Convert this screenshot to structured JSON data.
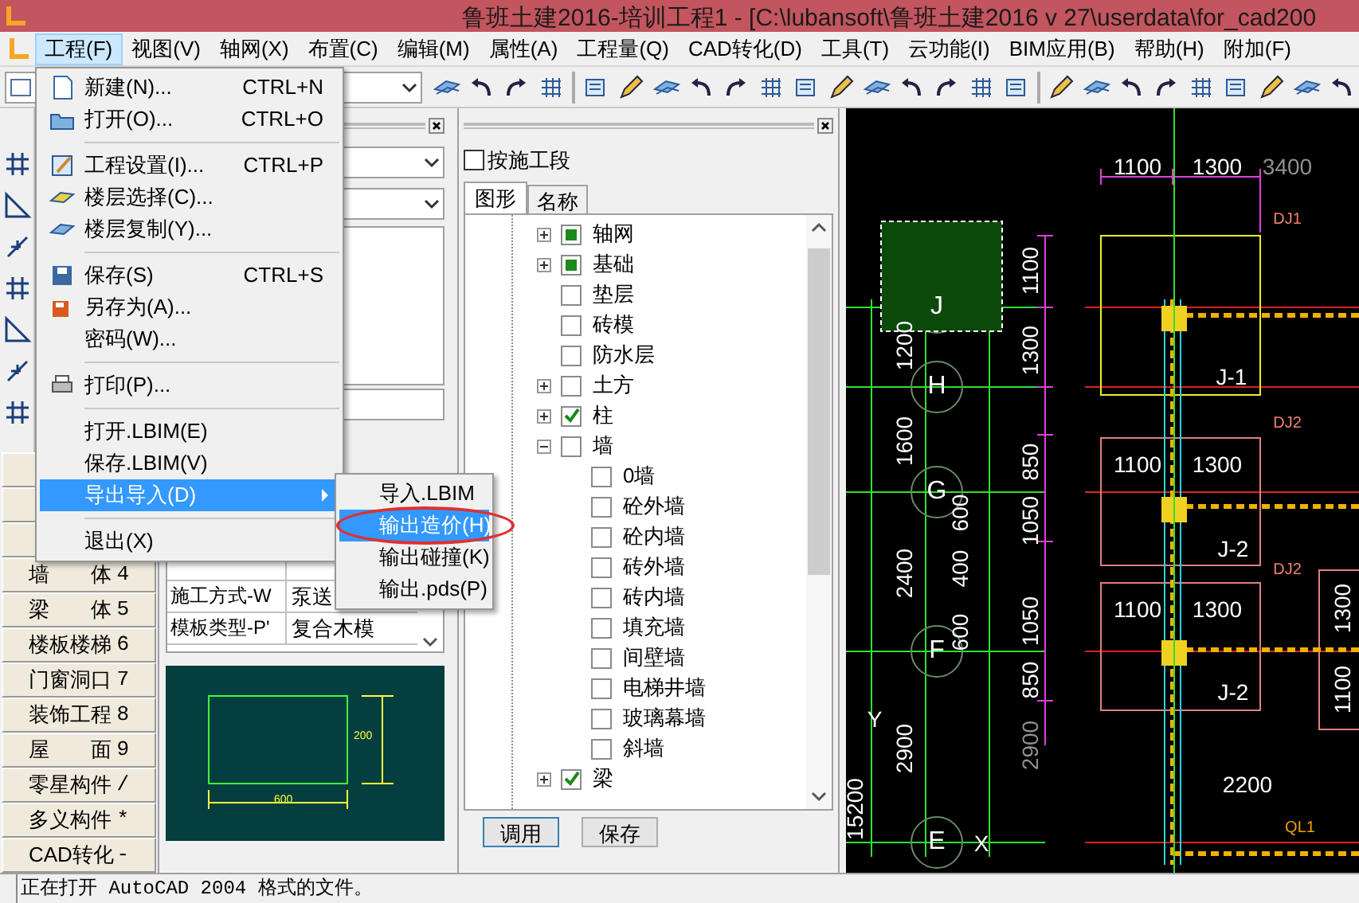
{
  "window": {
    "title": "鲁班土建2016-培训工程1 - [C:\\lubansoft\\鲁班土建2016 v 27\\userdata\\for_cad200"
  },
  "menubar": [
    {
      "label": "工程(F)",
      "selected": true
    },
    {
      "label": "视图(V)",
      "selected": false
    },
    {
      "label": "轴网(X)",
      "selected": false
    },
    {
      "label": "布置(C)",
      "selected": false
    },
    {
      "label": "编辑(M)",
      "selected": false
    },
    {
      "label": "属性(A)",
      "selected": false
    },
    {
      "label": "工程量(Q)",
      "selected": false
    },
    {
      "label": "CAD转化(D)",
      "selected": false
    },
    {
      "label": "工具(T)",
      "selected": false
    },
    {
      "label": "云功能(I)",
      "selected": false
    },
    {
      "label": "BIM应用(B)",
      "selected": false
    },
    {
      "label": "帮助(H)",
      "selected": false
    },
    {
      "label": "附加(F)",
      "selected": false
    }
  ],
  "file_menu": [
    {
      "kind": "item",
      "label": "新建(N)...",
      "shortcut": "CTRL+N",
      "selected": false
    },
    {
      "kind": "item",
      "label": "打开(O)...",
      "shortcut": "CTRL+O",
      "selected": false
    },
    {
      "kind": "separator"
    },
    {
      "kind": "item",
      "label": "工程设置(I)...",
      "shortcut": "CTRL+P",
      "selected": false
    },
    {
      "kind": "item",
      "label": "楼层选择(C)...",
      "selected": false
    },
    {
      "kind": "item",
      "label": "楼层复制(Y)...",
      "selected": false
    },
    {
      "kind": "separator"
    },
    {
      "kind": "item",
      "label": "保存(S)",
      "shortcut": "CTRL+S",
      "selected": false
    },
    {
      "kind": "item",
      "label": "另存为(A)...",
      "selected": false
    },
    {
      "kind": "item",
      "label": "密码(W)...",
      "selected": false
    },
    {
      "kind": "separator"
    },
    {
      "kind": "item",
      "label": "打印(P)...",
      "selected": false
    },
    {
      "kind": "separator"
    },
    {
      "kind": "item",
      "label": "打开.LBIM(E)",
      "selected": false
    },
    {
      "kind": "item",
      "label": "保存.LBIM(V)",
      "selected": false
    },
    {
      "kind": "submenu",
      "label": "导出导入(D)",
      "selected": true
    },
    {
      "kind": "separator"
    },
    {
      "kind": "item",
      "label": "退出(X)",
      "selected": false
    }
  ],
  "submenu": [
    {
      "label": "导入.LBIM",
      "selected": false,
      "circled": false
    },
    {
      "label": "输出造价(H)",
      "selected": true,
      "circled": true
    },
    {
      "label": "输出碰撞(K)",
      "selected": false,
      "circled": false
    },
    {
      "label": "输出.pds(P)",
      "selected": false,
      "circled": false
    }
  ],
  "left_panel": {
    "categories": [
      {
        "label": "墙　　体",
        "key": "4"
      },
      {
        "label": "梁　　体",
        "key": "5"
      },
      {
        "label": "楼板楼梯",
        "key": "6"
      },
      {
        "label": "门窗洞口",
        "key": "7"
      },
      {
        "label": "装饰工程",
        "key": "8"
      },
      {
        "label": "屋　　面",
        "key": "9"
      },
      {
        "label": "零星构件",
        "key": "/"
      },
      {
        "label": "多义构件",
        "key": "*"
      },
      {
        "label": "CAD转化",
        "key": "-"
      }
    ]
  },
  "properties": [
    {
      "name": "施工方式-W",
      "value": "泵送"
    },
    {
      "name": "模板类型-P'",
      "value": "复合木模"
    }
  ],
  "preview": {
    "height_label": "200",
    "width_label": "600"
  },
  "layer_panel": {
    "by_stage": {
      "label": "按施工段",
      "checked": false
    },
    "tabs": [
      {
        "label": "图形",
        "selected": true
      },
      {
        "label": "名称",
        "selected": false
      }
    ],
    "tree": [
      {
        "label": "轴网",
        "checked": false,
        "partial": true,
        "expanded": false
      },
      {
        "label": "基础",
        "checked": false,
        "partial": true,
        "expanded": false
      },
      {
        "label": "垫层",
        "checked": false,
        "partial": false
      },
      {
        "label": "砖模",
        "checked": false,
        "partial": false
      },
      {
        "label": "防水层",
        "checked": false,
        "partial": false
      },
      {
        "label": "土方",
        "checked": false,
        "partial": false,
        "expanded": false
      },
      {
        "label": "柱",
        "checked": true,
        "expanded": false
      },
      {
        "label": "墙",
        "checked": false,
        "partial": false,
        "expanded": true,
        "children": [
          {
            "label": "0墙",
            "checked": false
          },
          {
            "label": "砼外墙",
            "checked": false
          },
          {
            "label": "砼内墙",
            "checked": false
          },
          {
            "label": "砖外墙",
            "checked": false
          },
          {
            "label": "砖内墙",
            "checked": false
          },
          {
            "label": "填充墙",
            "checked": false
          },
          {
            "label": "间壁墙",
            "checked": false
          },
          {
            "label": "电梯井墙",
            "checked": false
          },
          {
            "label": "玻璃幕墙",
            "checked": false
          },
          {
            "label": "斜墙",
            "checked": false
          }
        ]
      },
      {
        "label": "梁",
        "checked": true,
        "expanded": false
      }
    ],
    "buttons": [
      "调用",
      "保存"
    ]
  },
  "cad_labels": [
    {
      "text": "1100",
      "kind": "dim"
    },
    {
      "text": "1300",
      "kind": "dim"
    },
    {
      "text": "3400",
      "kind": "grey"
    },
    {
      "text": "DJ1",
      "kind": "tag"
    },
    {
      "text": "J-1",
      "kind": "dim"
    },
    {
      "text": "DJ2",
      "kind": "tag"
    },
    {
      "text": "J-2",
      "kind": "dim"
    },
    {
      "text": "DJ2",
      "kind": "tag"
    },
    {
      "text": "J-2",
      "kind": "dim"
    },
    {
      "text": "2200",
      "kind": "dim"
    },
    {
      "text": "QL1",
      "kind": "beam"
    },
    {
      "text": "1200",
      "kind": "vdim"
    },
    {
      "text": "1600",
      "kind": "vdim"
    },
    {
      "text": "2400",
      "kind": "vdim"
    },
    {
      "text": "2900",
      "kind": "vdim"
    },
    {
      "text": "15200",
      "kind": "vdim"
    },
    {
      "text": "1100",
      "kind": "vdim"
    },
    {
      "text": "1300",
      "kind": "vdim"
    },
    {
      "text": "850",
      "kind": "vdim"
    },
    {
      "text": "1050",
      "kind": "vdim"
    },
    {
      "text": "1050",
      "kind": "vdim"
    },
    {
      "text": "850",
      "kind": "vdim"
    },
    {
      "text": "2900",
      "kind": "vgrey"
    },
    {
      "text": "600",
      "kind": "vdim"
    },
    {
      "text": "400",
      "kind": "vdim"
    },
    {
      "text": "600",
      "kind": "vdim"
    },
    {
      "text": "1100",
      "kind": "dim"
    },
    {
      "text": "1300",
      "kind": "dim"
    },
    {
      "text": "1100",
      "kind": "dim"
    },
    {
      "text": "1300",
      "kind": "dim"
    },
    {
      "text": "1300",
      "kind": "vdim"
    },
    {
      "text": "1100",
      "kind": "vdim"
    },
    {
      "text": "J",
      "kind": "axis"
    },
    {
      "text": "H",
      "kind": "axis"
    },
    {
      "text": "G",
      "kind": "axis"
    },
    {
      "text": "F",
      "kind": "axis"
    },
    {
      "text": "E",
      "kind": "axis"
    },
    {
      "text": "Y",
      "kind": "dim"
    },
    {
      "text": "X",
      "kind": "dim"
    }
  ],
  "status_bar": "正在打开 AutoCAD 2004 格式的文件。"
}
